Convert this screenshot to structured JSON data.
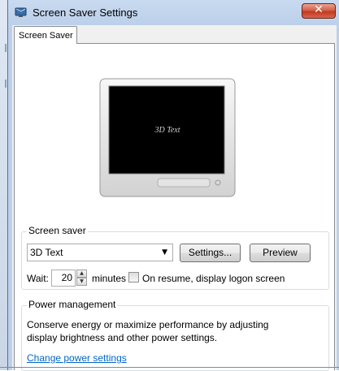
{
  "window": {
    "title": "Screen Saver Settings",
    "close_glyph": "✕"
  },
  "tabs": [
    {
      "label": "Screen Saver"
    }
  ],
  "preview": {
    "screen_text": "3D Text"
  },
  "screen_saver": {
    "group_label": "Screen saver",
    "selected": "3D Text",
    "settings_label": "Settings...",
    "preview_label": "Preview",
    "wait_label": "Wait:",
    "wait_value": "20",
    "minutes_label": "minutes",
    "resume_label": "On resume, display logon screen",
    "resume_checked": false
  },
  "power": {
    "group_label": "Power management",
    "description_line1": "Conserve energy or maximize performance by adjusting",
    "description_line2": "display brightness and other power settings.",
    "link_label": "Change power settings"
  },
  "colors": {
    "accent_link": "#0066cc",
    "close_red": "#c03a20",
    "title_bar": "#c9daf0"
  }
}
